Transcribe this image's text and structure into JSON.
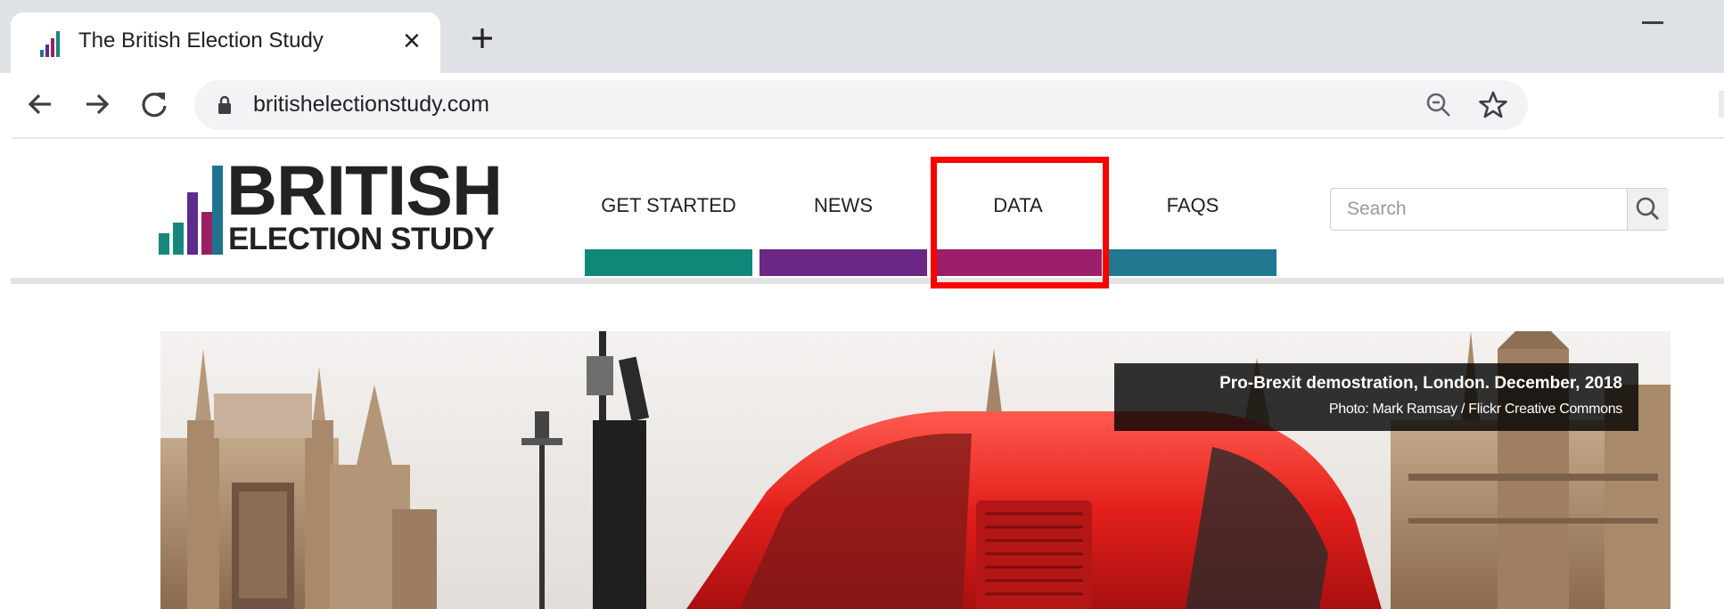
{
  "browser": {
    "tab": {
      "title": "The British Election Study"
    },
    "address_bar": {
      "url": "britishelectionstudy.com"
    },
    "icons": [
      "bar-chart-favicon",
      "close-icon",
      "plus-icon",
      "back-arrow-icon",
      "forward-arrow-icon",
      "reload-icon",
      "lock-icon",
      "zoom-out-icon",
      "star-icon",
      "minimize-icon"
    ]
  },
  "site": {
    "logo": {
      "line1": "BRITISH",
      "line2": "ELECTION STUDY",
      "bar_colors": [
        "#16877d",
        "#5d2b8e",
        "#9b2063",
        "#1f7390"
      ]
    },
    "nav": {
      "items": [
        {
          "label": "GET STARTED",
          "color": "#0f8779"
        },
        {
          "label": "NEWS",
          "color": "#6b2784"
        },
        {
          "label": "DATA",
          "color": "#9b1f69"
        },
        {
          "label": "FAQS",
          "color": "#1f7890"
        }
      ]
    },
    "search": {
      "placeholder": "Search",
      "icon": "search-icon"
    }
  },
  "hero": {
    "caption_title": "Pro-Brexit demostration, London. December, 2018",
    "caption_credit": "Photo: Mark Ramsay / Flickr Creative Commons"
  },
  "annotation": {
    "highlight_color": "#ff0000",
    "highlighted_item": "DATA"
  }
}
